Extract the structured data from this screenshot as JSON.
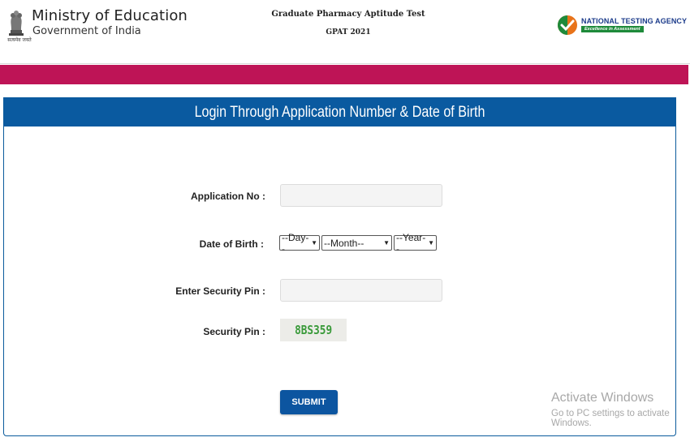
{
  "header": {
    "ministry_name": "Ministry of Education",
    "government": "Government of India",
    "emblem_text": "सत्यमेव जयते",
    "exam_title": "Graduate Pharmacy Aptitude Test",
    "exam_code": "GPAT 2021",
    "agency_name": "NATIONAL TESTING AGENCY",
    "agency_tagline": "Excellence in Assessment"
  },
  "colors": {
    "band": "#be1456",
    "panel_header": "#0a5aa0",
    "submit": "#0c55a0",
    "captcha_text": "#3a9a3a"
  },
  "login": {
    "heading": "Login Through Application Number & Date of Birth",
    "application_label": "Application No :",
    "application_value": "",
    "dob_label": "Date of Birth :",
    "day_selected": "--Day--",
    "month_selected": "--Month--",
    "year_selected": "--Year--",
    "security_pin_input_label": "Enter Security Pin :",
    "security_pin_input_value": "",
    "security_pin_label": "Security Pin :",
    "security_pin_code": "8BS359",
    "submit_label": "SUBMIT"
  },
  "watermark": {
    "line1": "Activate Windows",
    "line2": "Go to PC settings to activate Windows."
  }
}
